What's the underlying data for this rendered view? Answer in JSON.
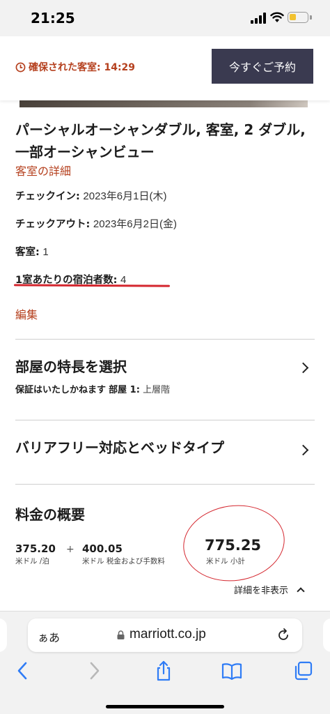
{
  "status_bar": {
    "time": "21:25"
  },
  "hold": {
    "timer_text": "確保された客室: 14:29",
    "book_button": "今すぐご予約"
  },
  "room": {
    "title": "パーシャルオーシャンダブル, 客室, 2 ダブル, 一部オーシャンビュー",
    "details_link": "客室の詳細",
    "checkin_label": "チェックイン:",
    "checkin_value": "2023年6月1日(木)",
    "checkout_label": "チェックアウト:",
    "checkout_value": "2023年6月2日(金)",
    "rooms_label": "客室:",
    "rooms_value": "1",
    "guests_label": "1室あたりの宿泊者数:",
    "guests_value": "4",
    "edit_link": "編集"
  },
  "features": {
    "title": "部屋の特長を選択",
    "note": "保証はいたしかねます",
    "room_label": "部屋 1:",
    "room_value": "上層階"
  },
  "accessibility": {
    "title": "バリアフリー対応とベッドタイプ"
  },
  "pricing": {
    "title": "料金の概要",
    "rate_value": "375.20",
    "rate_unit": "米ドル /泊",
    "plus": "+",
    "tax_value": "400.05",
    "tax_unit": "米ドル 税金および手数料",
    "subtotal_value": "775.25",
    "subtotal_unit": "米ドル 小計",
    "hide_details": "詳細を非表示"
  },
  "browser": {
    "aa_label": "ぁあ",
    "url": "marriott.co.jp"
  },
  "colors": {
    "accent_red": "#b5401e",
    "button_dark": "#3a3a50",
    "annotation_red": "#d4262e"
  }
}
